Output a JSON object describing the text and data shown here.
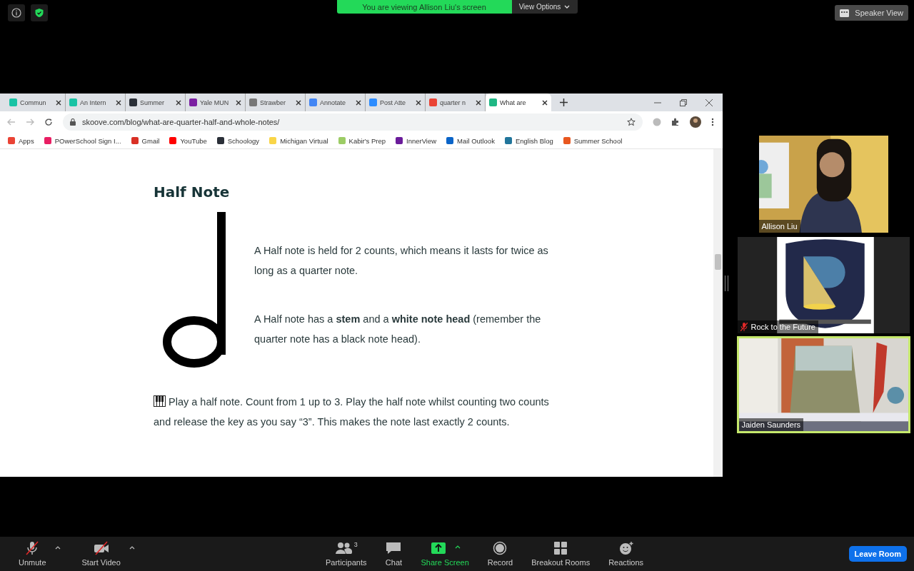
{
  "meeting_bar": {
    "banner": "You are viewing Allison Liu's screen",
    "view_options": "View Options",
    "speaker_view": "Speaker View"
  },
  "browser": {
    "tabs": [
      {
        "label": "Commun",
        "color": "#19c3a5",
        "selected": false
      },
      {
        "label": "An Intern",
        "color": "#19c3a5",
        "selected": false
      },
      {
        "label": "Summer",
        "color": "#2a2f38",
        "selected": false
      },
      {
        "label": "Yale MUN",
        "color": "#7b1fa2",
        "selected": false
      },
      {
        "label": "Strawber",
        "color": "#777777",
        "selected": false
      },
      {
        "label": "Annotate",
        "color": "#4285f4",
        "selected": false
      },
      {
        "label": "Post Atte",
        "color": "#2d8cff",
        "selected": false
      },
      {
        "label": "quarter n",
        "color": "#ea4335",
        "selected": false
      },
      {
        "label": "What are",
        "color": "#1fb784",
        "selected": true
      }
    ],
    "url": "skoove.com/blog/what-are-quarter-half-and-whole-notes/",
    "bookmarks": [
      {
        "label": "Apps",
        "color": "#ea4335"
      },
      {
        "label": "POwerSchool Sign I...",
        "color": "#e91e63"
      },
      {
        "label": "Gmail",
        "color": "#d93025"
      },
      {
        "label": "YouTube",
        "color": "#ff0000"
      },
      {
        "label": "Schoology",
        "color": "#2a2f38"
      },
      {
        "label": "Michigan Virtual",
        "color": "#f9d548"
      },
      {
        "label": "Kabir's Prep",
        "color": "#9ccc65"
      },
      {
        "label": "InnerView",
        "color": "#6a1b9a"
      },
      {
        "label": "Mail Outlook",
        "color": "#0a64c8"
      },
      {
        "label": "English Blog",
        "color": "#21759b"
      },
      {
        "label": "Summer School",
        "color": "#e8571f"
      }
    ],
    "article": {
      "heading": "Half Note",
      "paragraphs": [
        "A Half note is held for 2 counts, which means it lasts for twice as long as a quarter note.",
        "A Half note has a **stem** and a **white note head** (remember the quarter note has a black note head)."
      ],
      "tip": "Play a half note. Count from 1 up to 3. Play the half note whilst counting two counts and release the key as you say “3”. This makes the note last exactly 2 counts."
    }
  },
  "videos": [
    {
      "name": "Allison Liu",
      "muted": false,
      "speaking": false
    },
    {
      "name": "Rock to the Future",
      "muted": true,
      "speaking": false
    },
    {
      "name": "Jaiden Saunders",
      "muted": false,
      "speaking": true
    }
  ],
  "toolbar": {
    "left": [
      {
        "label": "Unmute",
        "kind": "mic",
        "off": true
      },
      {
        "label": "Start Video",
        "kind": "camera",
        "off": true
      }
    ],
    "center": [
      {
        "label": "Participants",
        "kind": "participants",
        "count": "3"
      },
      {
        "label": "Chat",
        "kind": "chat"
      },
      {
        "label": "Share Screen",
        "kind": "share"
      },
      {
        "label": "Record",
        "kind": "record"
      },
      {
        "label": "Breakout Rooms",
        "kind": "breakout"
      },
      {
        "label": "Reactions",
        "kind": "reactions"
      }
    ],
    "leave": "Leave Room"
  }
}
